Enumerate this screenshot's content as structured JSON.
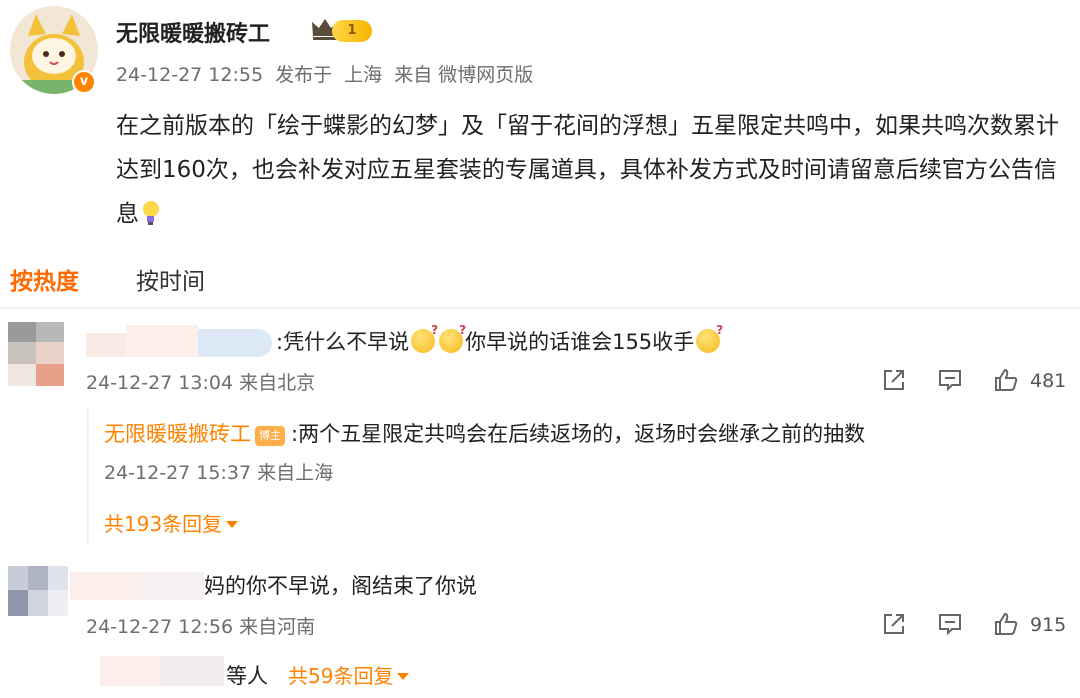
{
  "post": {
    "author": "无限暖暖搬砖工",
    "level": "1",
    "timestamp": "24-12-27 12:55",
    "posted_at": "发布于",
    "location": "上海",
    "source": "来自 微博网页版",
    "body": "在之前版本的「绘于蝶影的幻梦」及「留于花间的浮想」五星限定共鸣中，如果共鸣次数累计达到160次，也会补发对应五星套装的专属道具，具体补发方式及时间请留意后续官方公告信息",
    "verify_mark": "v"
  },
  "sort_tabs": {
    "hot": "按热度",
    "time": "按时间"
  },
  "comments": [
    {
      "text_part1": ":凭什么不早说",
      "text_part2": "你早说的话谁会155收手",
      "timestamp": "24-12-27 13:04",
      "location": "来自北京",
      "likes": "481",
      "reply": {
        "author": "无限暖暖搬砖工",
        "author_tag": "博主",
        "text": ":两个五星限定共鸣会在后续返场的，返场时会继承之前的抽数",
        "timestamp": "24-12-27 15:37",
        "location": "来自上海"
      },
      "more_replies": "共193条回复"
    },
    {
      "text": "妈的你不早说，阁结束了你说",
      "timestamp": "24-12-27 12:56",
      "location": "来自河南",
      "likes": "915",
      "others": "等人",
      "more_replies": "共59条回复"
    }
  ],
  "colors": {
    "accent": "#ff8200",
    "tab_active": "#ff6a00",
    "meta": "#6d6d6d"
  }
}
